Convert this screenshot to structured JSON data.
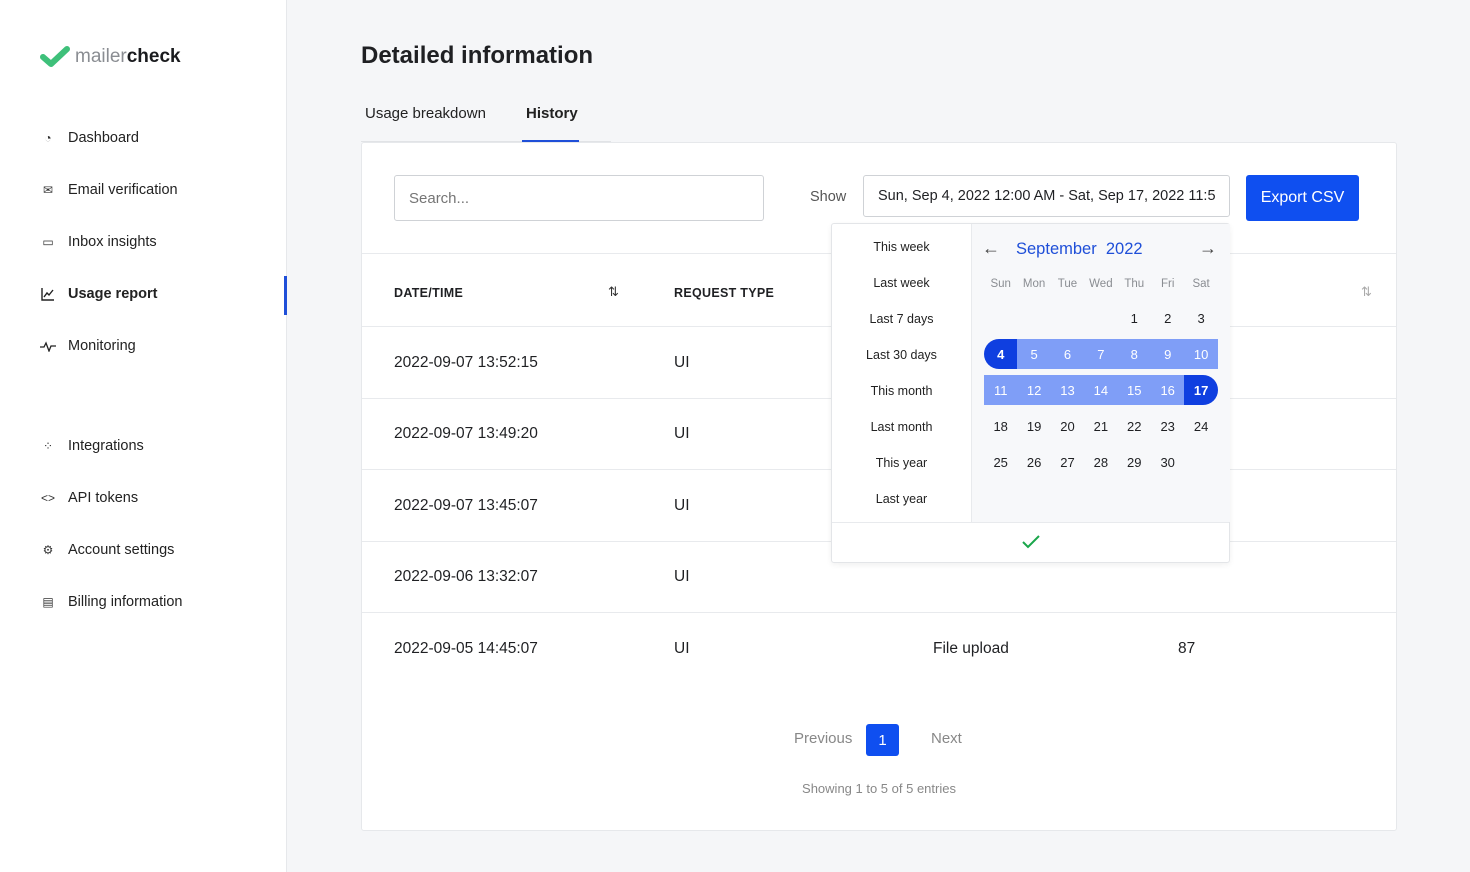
{
  "brand": {
    "light": "mailer",
    "bold": "check",
    "accent": "#3ec07a"
  },
  "sidebar": {
    "items": [
      {
        "label": "Dashboard",
        "icon": "pie-chart-icon"
      },
      {
        "label": "Email verification",
        "icon": "mail-check-icon"
      },
      {
        "label": "Inbox insights",
        "icon": "inbox-icon"
      },
      {
        "label": "Usage report",
        "icon": "line-chart-icon",
        "active": true
      },
      {
        "label": "Monitoring",
        "icon": "pulse-icon"
      },
      {
        "label": "Integrations",
        "icon": "grid-icon"
      },
      {
        "label": "API tokens",
        "icon": "code-icon"
      },
      {
        "label": "Account settings",
        "icon": "gear-icon"
      },
      {
        "label": "Billing information",
        "icon": "card-icon"
      }
    ]
  },
  "page": {
    "title": "Detailed information",
    "tabs": [
      {
        "label": "Usage breakdown"
      },
      {
        "label": "History",
        "active": true
      }
    ]
  },
  "toolbar": {
    "search_placeholder": "Search...",
    "show_label": "Show",
    "date_range": "Sun, Sep 4, 2022 12:00 AM - Sat, Sep 17, 2022 11:5",
    "export_label": "Export CSV"
  },
  "table": {
    "columns": [
      "DATE/TIME",
      "REQUEST TYPE"
    ],
    "rows": [
      {
        "datetime": "2022-09-07 13:52:15",
        "type": "UI"
      },
      {
        "datetime": "2022-09-07 13:49:20",
        "type": "UI"
      },
      {
        "datetime": "2022-09-07 13:45:07",
        "type": "UI"
      },
      {
        "datetime": "2022-09-06 13:32:07",
        "type": "UI"
      },
      {
        "datetime": "2022-09-05 14:45:07",
        "type": "UI",
        "source": "File upload",
        "count": "87"
      }
    ]
  },
  "pagination": {
    "previous": "Previous",
    "current": "1",
    "next": "Next",
    "summary": "Showing 1 to 5 of 5 entries"
  },
  "datepicker": {
    "presets": [
      "This week",
      "Last week",
      "Last 7 days",
      "Last 30 days",
      "This month",
      "Last month",
      "This year",
      "Last year"
    ],
    "month_title": "September  2022",
    "weekdays": [
      "Sun",
      "Mon",
      "Tue",
      "Wed",
      "Thu",
      "Fri",
      "Sat"
    ],
    "weeks": [
      [
        "",
        "",
        "",
        "",
        "1",
        "2",
        "3"
      ],
      [
        "4",
        "5",
        "6",
        "7",
        "8",
        "9",
        "10"
      ],
      [
        "11",
        "12",
        "13",
        "14",
        "15",
        "16",
        "17"
      ],
      [
        "18",
        "19",
        "20",
        "21",
        "22",
        "23",
        "24"
      ],
      [
        "25",
        "26",
        "27",
        "28",
        "29",
        "30",
        ""
      ]
    ],
    "range_start": 4,
    "range_end": 17,
    "today": 30,
    "confirm_icon": "check-icon"
  }
}
